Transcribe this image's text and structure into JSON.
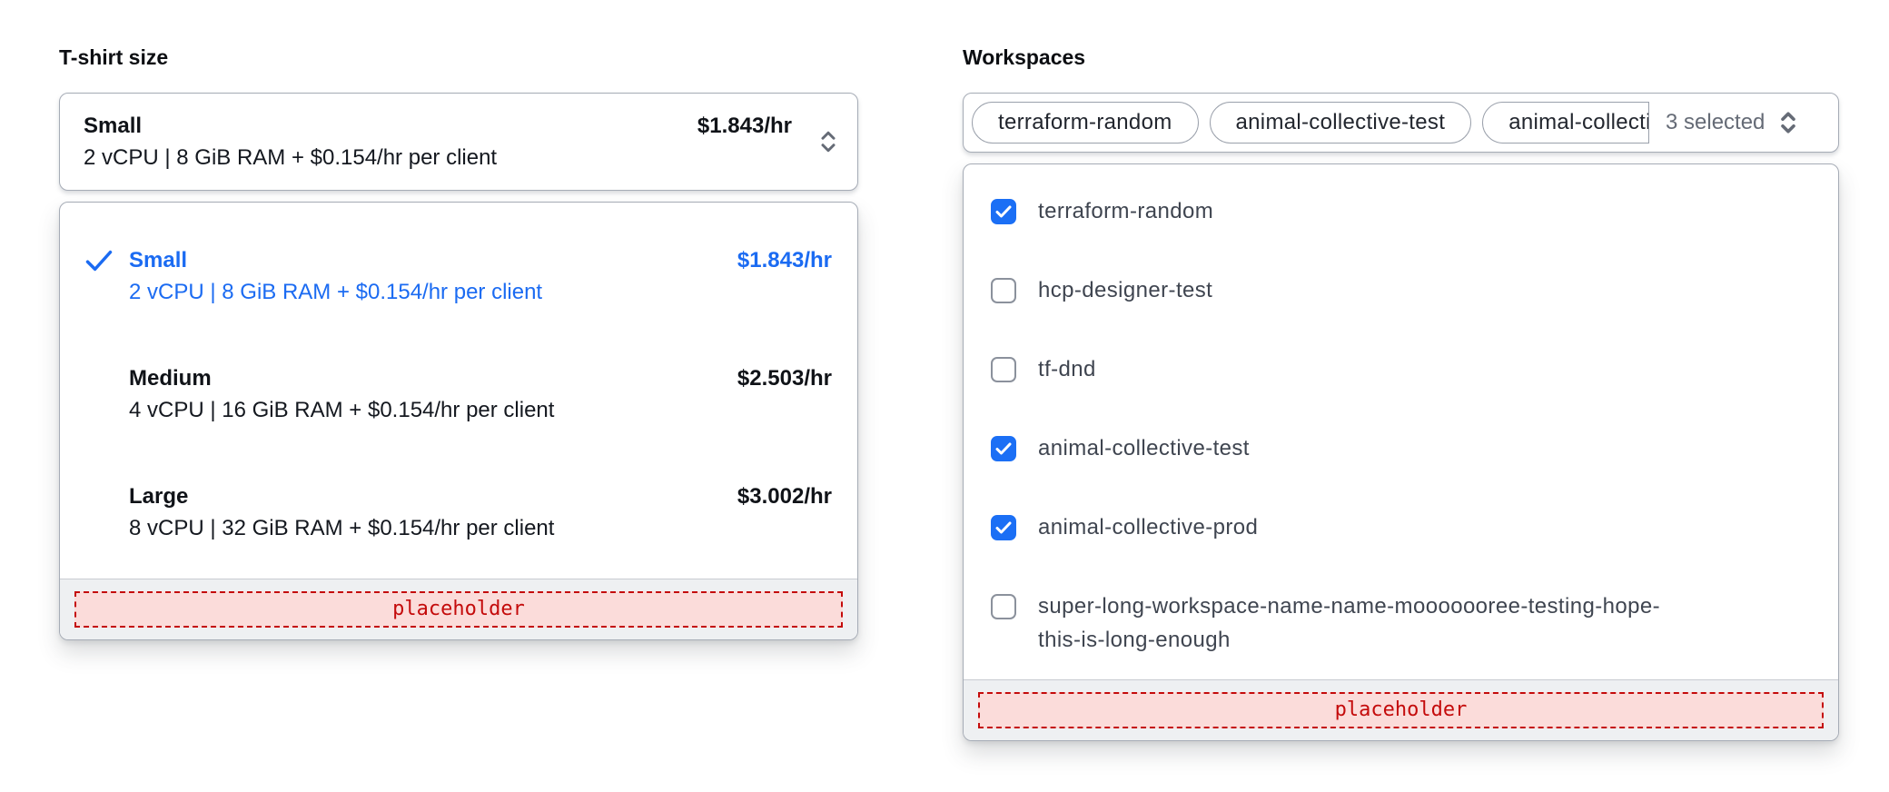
{
  "tshirt": {
    "label": "T-shirt size",
    "trigger": {
      "title": "Small",
      "description": "2 vCPU | 8 GiB RAM + $0.154/hr per client",
      "price": "$1.843/hr"
    },
    "options": [
      {
        "title": "Small",
        "description": "2 vCPU | 8 GiB RAM + $0.154/hr per client",
        "price": "$1.843/hr",
        "selected": true
      },
      {
        "title": "Medium",
        "description": "4 vCPU | 16 GiB RAM + $0.154/hr per client",
        "price": "$2.503/hr",
        "selected": false
      },
      {
        "title": "Large",
        "description": "8 vCPU | 32 GiB RAM + $0.154/hr per client",
        "price": "$3.002/hr",
        "selected": false
      }
    ],
    "footer_placeholder": "placeholder"
  },
  "workspaces": {
    "label": "Workspaces",
    "trigger": {
      "chips": [
        "terraform-random",
        "animal-collective-test",
        "animal-collective-prod"
      ],
      "summary": "3 selected"
    },
    "options": [
      {
        "label": "terraform-random",
        "checked": true
      },
      {
        "label": "hcp-designer-test",
        "checked": false
      },
      {
        "label": "tf-dnd",
        "checked": false
      },
      {
        "label": "animal-collective-test",
        "checked": true
      },
      {
        "label": "animal-collective-prod",
        "checked": true
      },
      {
        "label": "super-long-workspace-name-name-mooooooree-testing-hope-this-is-long-enough",
        "checked": false
      }
    ],
    "footer_placeholder": "placeholder"
  },
  "colors": {
    "accent_blue_text": "#1b6bf2",
    "checkbox_blue": "#1b6ff5",
    "placeholder_red": "#c40b0b",
    "placeholder_bg": "#fbdcda",
    "border_gray": "#a6acb6",
    "footer_bg": "#eef0f2",
    "muted_text": "#656b76"
  },
  "icons": [
    "chevron-up-down-icon",
    "checkmark-icon",
    "checkbox-tick-icon"
  ]
}
